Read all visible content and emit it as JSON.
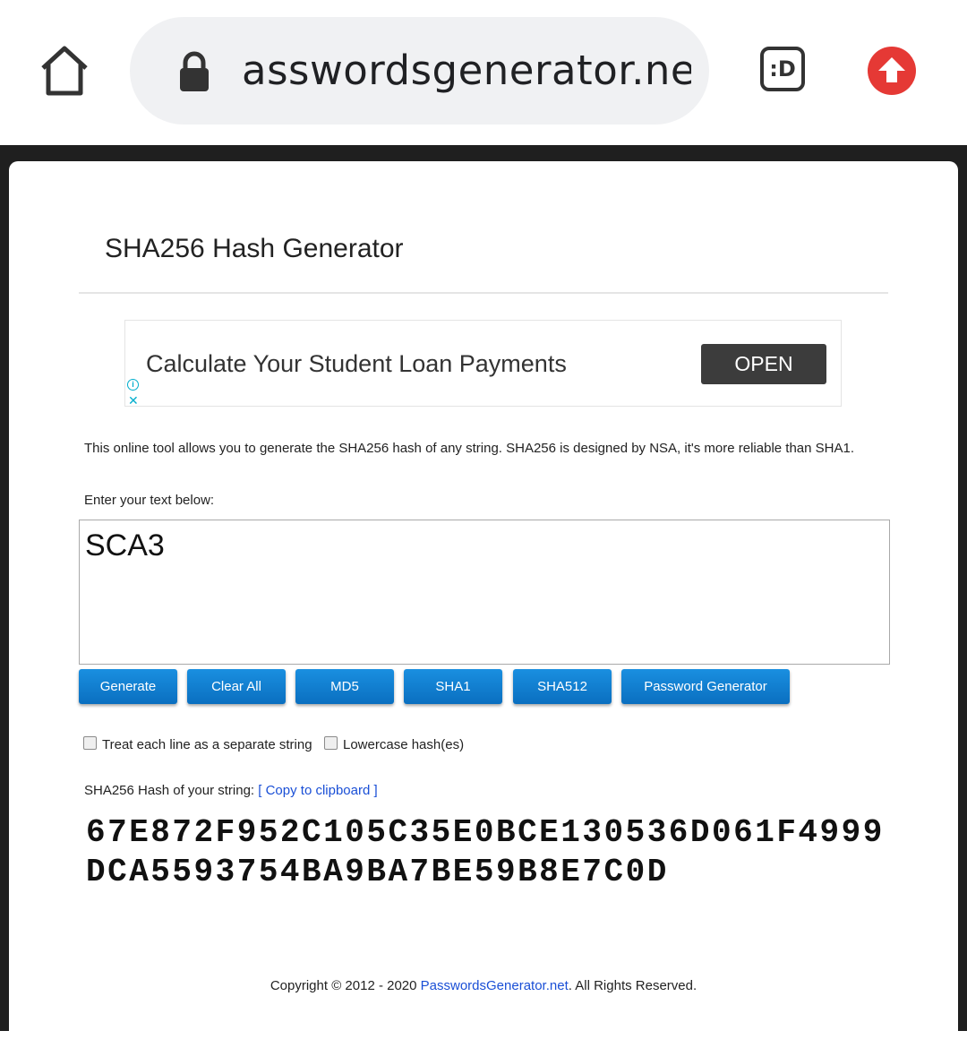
{
  "browser": {
    "url_text": "asswordsgenerator.net",
    "tabs_label": ":D",
    "home_icon": "home-icon",
    "lock_icon": "lock-icon",
    "update_icon": "update-arrow-icon",
    "update_color": "#e53935"
  },
  "page": {
    "title": "SHA256 Hash Generator",
    "ad": {
      "text": "Calculate Your Student Loan Payments",
      "button": "OPEN",
      "info_glyph": "i",
      "close_glyph": "✕"
    },
    "description": "This online tool allows you to generate the SHA256 hash of any string. SHA256 is designed by NSA, it's more reliable than SHA1.",
    "enter_label": "Enter your text below:",
    "input_value": "SCA3",
    "buttons": [
      "Generate",
      "Clear All",
      "MD5",
      "SHA1",
      "SHA512",
      "Password Generator"
    ],
    "options": {
      "separate_lines": "Treat each line as a separate string",
      "lowercase": "Lowercase hash(es)"
    },
    "hash_label": "SHA256 Hash of your string:",
    "copy_link": "[ Copy to clipboard ]",
    "hash_value": "67E872F952C105C35E0BCE130536D061F4999DCA5593754BA9BA7BE59B8E7C0D",
    "footer": {
      "prefix": "Copyright © 2012 - 2020 ",
      "link": "PasswordsGenerator.net",
      "suffix": ". All Rights Reserved."
    },
    "button_color": "#0a7fd6",
    "link_color": "#1a4fd6"
  }
}
